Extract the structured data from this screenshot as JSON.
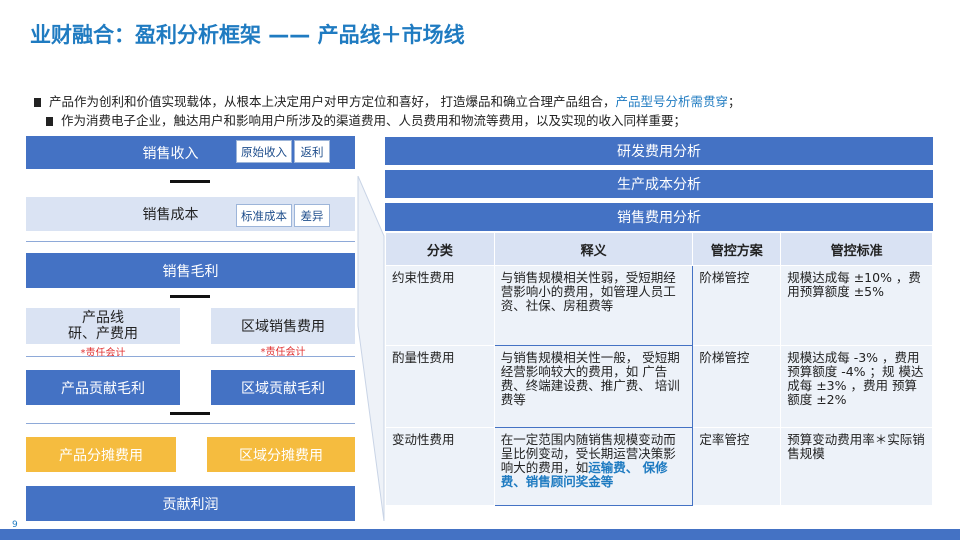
{
  "title": "业财融合：盈利分析框架 —— 产品线＋市场线",
  "bullets": {
    "b1_prefix": "产品作为创利和价值实现载体，从根本上决定用户对甲方定位和喜好，  打造爆品和确立合理产品组合，",
    "b1_highlight": "产品型号分析需贯穿",
    "b1_suffix": "；",
    "b2": "作为消费电子企业，触达用户和影响用户所涉及的渠道费用、人员费用和物流等费用，以及实现的收入同样重要；"
  },
  "flow": {
    "sales_income": "销售收入",
    "tag_original_income": "原始收入",
    "tag_rebate": "返利",
    "sales_cost": "销售成本",
    "tag_standard_cost": "标准成本",
    "tag_variance": "差异",
    "gross_profit": "销售毛利",
    "product_line_line1": "产品线",
    "product_line_line2": "研、产费用",
    "regional_sales_expense": "区域销售费用",
    "note_left": "*责任会计",
    "note_right": "*责任会计",
    "product_contribution_margin": "产品贡献毛利",
    "regional_contribution_margin": "区域贡献毛利",
    "product_allocated_expense": "产品分摊费用",
    "regional_allocated_expense": "区域分摊费用",
    "contribution_profit": "贡献利润"
  },
  "right": {
    "rd_analysis": "研发费用分析",
    "production_cost_analysis": "生产成本分析",
    "sales_expense_analysis": "销售费用分析",
    "columns": [
      "分类",
      "释义",
      "管控方案",
      "管控标准"
    ],
    "rows": [
      {
        "category": "约束性费用",
        "explanation": "与销售规模相关性弱，受短期经营影响小的费用，如管理人员工资、社保、房租费等",
        "scheme": "阶梯管控",
        "standard": "规模达成每 ±10% ，费用预算额度 ±5%"
      },
      {
        "category": "酌量性费用",
        "explanation": "与销售规模相关性一般， 受短期经营影响较大的费用，如 广告费、终端建设费、推广费、 培训费等",
        "scheme": "阶梯管控",
        "standard": "规模达成每 -3% ，费用预算额度 -4% ；规 模达成每 ±3% ，费用 预算额度 ±2%"
      },
      {
        "category": "变动性费用",
        "explanation_prefix": "在一定范围内随销售规模变动而呈比例变动，受长期运营决策影响大的费用，如",
        "explanation_highlight": "运输费、 保修费、销售顾问奖金等",
        "scheme": "定率管控",
        "standard": "预算变动费用率＊实际销售规模"
      }
    ]
  },
  "page_number": "9"
}
